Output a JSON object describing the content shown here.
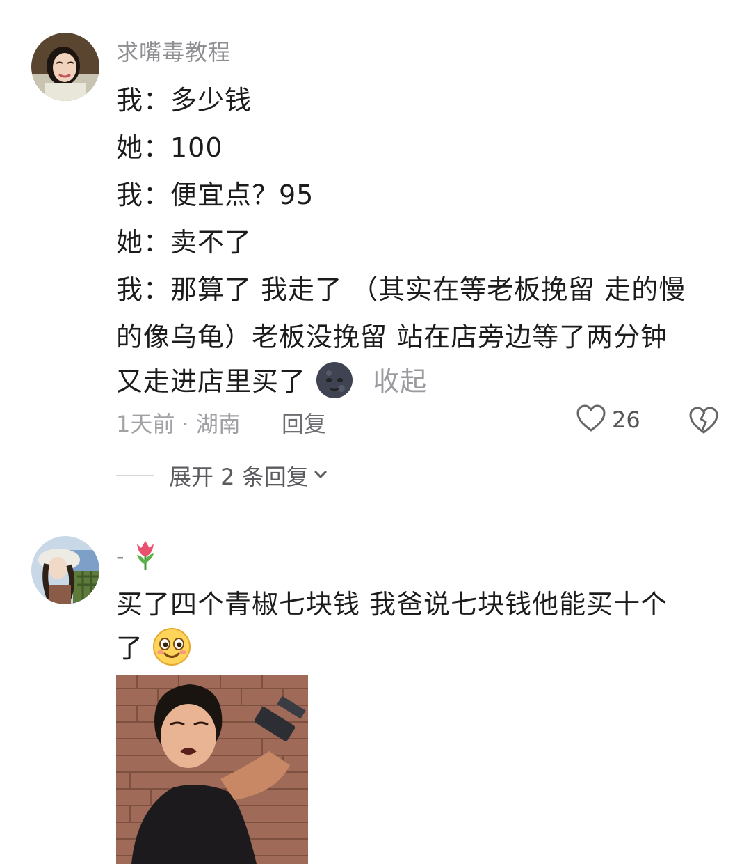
{
  "comments": [
    {
      "username": "求嘴毒教程",
      "lines": [
        "我：多少钱",
        "她：100",
        "我：便宜点？95",
        "她：卖不了",
        "我：那算了 我走了 （其实在等老板挽留 走的慢",
        "的像乌龟）老板没挽留 站在店旁边等了两分钟",
        "又走进店里买了"
      ],
      "emoji": "new-moon-face-emoji",
      "collapse_label": "收起",
      "meta": "1天前 · 湖南",
      "reply_label": "回复",
      "like_count": "26",
      "expand_label": "展开 2 条回复"
    },
    {
      "username": "-",
      "username_emoji": "tulip-emoji",
      "lines": [
        "买了四个青椒七块钱  我爸说七块钱他能买十个",
        "了"
      ],
      "emoji": "smiling-face-emoji"
    }
  ],
  "colors": {
    "text": "#1c1c1c",
    "secondary": "#8e8e93",
    "background": "#ffffff"
  }
}
